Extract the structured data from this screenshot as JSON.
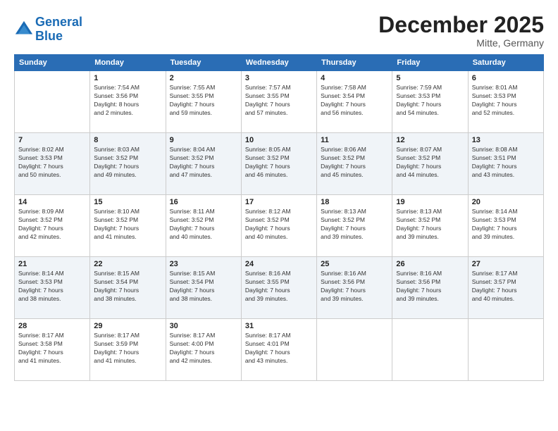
{
  "header": {
    "logo_line1": "General",
    "logo_line2": "Blue",
    "month": "December 2025",
    "location": "Mitte, Germany"
  },
  "weekdays": [
    "Sunday",
    "Monday",
    "Tuesday",
    "Wednesday",
    "Thursday",
    "Friday",
    "Saturday"
  ],
  "weeks": [
    [
      {
        "day": "",
        "info": ""
      },
      {
        "day": "1",
        "info": "Sunrise: 7:54 AM\nSunset: 3:56 PM\nDaylight: 8 hours\nand 2 minutes."
      },
      {
        "day": "2",
        "info": "Sunrise: 7:55 AM\nSunset: 3:55 PM\nDaylight: 7 hours\nand 59 minutes."
      },
      {
        "day": "3",
        "info": "Sunrise: 7:57 AM\nSunset: 3:55 PM\nDaylight: 7 hours\nand 57 minutes."
      },
      {
        "day": "4",
        "info": "Sunrise: 7:58 AM\nSunset: 3:54 PM\nDaylight: 7 hours\nand 56 minutes."
      },
      {
        "day": "5",
        "info": "Sunrise: 7:59 AM\nSunset: 3:53 PM\nDaylight: 7 hours\nand 54 minutes."
      },
      {
        "day": "6",
        "info": "Sunrise: 8:01 AM\nSunset: 3:53 PM\nDaylight: 7 hours\nand 52 minutes."
      }
    ],
    [
      {
        "day": "7",
        "info": "Sunrise: 8:02 AM\nSunset: 3:53 PM\nDaylight: 7 hours\nand 50 minutes."
      },
      {
        "day": "8",
        "info": "Sunrise: 8:03 AM\nSunset: 3:52 PM\nDaylight: 7 hours\nand 49 minutes."
      },
      {
        "day": "9",
        "info": "Sunrise: 8:04 AM\nSunset: 3:52 PM\nDaylight: 7 hours\nand 47 minutes."
      },
      {
        "day": "10",
        "info": "Sunrise: 8:05 AM\nSunset: 3:52 PM\nDaylight: 7 hours\nand 46 minutes."
      },
      {
        "day": "11",
        "info": "Sunrise: 8:06 AM\nSunset: 3:52 PM\nDaylight: 7 hours\nand 45 minutes."
      },
      {
        "day": "12",
        "info": "Sunrise: 8:07 AM\nSunset: 3:52 PM\nDaylight: 7 hours\nand 44 minutes."
      },
      {
        "day": "13",
        "info": "Sunrise: 8:08 AM\nSunset: 3:51 PM\nDaylight: 7 hours\nand 43 minutes."
      }
    ],
    [
      {
        "day": "14",
        "info": "Sunrise: 8:09 AM\nSunset: 3:52 PM\nDaylight: 7 hours\nand 42 minutes."
      },
      {
        "day": "15",
        "info": "Sunrise: 8:10 AM\nSunset: 3:52 PM\nDaylight: 7 hours\nand 41 minutes."
      },
      {
        "day": "16",
        "info": "Sunrise: 8:11 AM\nSunset: 3:52 PM\nDaylight: 7 hours\nand 40 minutes."
      },
      {
        "day": "17",
        "info": "Sunrise: 8:12 AM\nSunset: 3:52 PM\nDaylight: 7 hours\nand 40 minutes."
      },
      {
        "day": "18",
        "info": "Sunrise: 8:13 AM\nSunset: 3:52 PM\nDaylight: 7 hours\nand 39 minutes."
      },
      {
        "day": "19",
        "info": "Sunrise: 8:13 AM\nSunset: 3:52 PM\nDaylight: 7 hours\nand 39 minutes."
      },
      {
        "day": "20",
        "info": "Sunrise: 8:14 AM\nSunset: 3:53 PM\nDaylight: 7 hours\nand 39 minutes."
      }
    ],
    [
      {
        "day": "21",
        "info": "Sunrise: 8:14 AM\nSunset: 3:53 PM\nDaylight: 7 hours\nand 38 minutes."
      },
      {
        "day": "22",
        "info": "Sunrise: 8:15 AM\nSunset: 3:54 PM\nDaylight: 7 hours\nand 38 minutes."
      },
      {
        "day": "23",
        "info": "Sunrise: 8:15 AM\nSunset: 3:54 PM\nDaylight: 7 hours\nand 38 minutes."
      },
      {
        "day": "24",
        "info": "Sunrise: 8:16 AM\nSunset: 3:55 PM\nDaylight: 7 hours\nand 39 minutes."
      },
      {
        "day": "25",
        "info": "Sunrise: 8:16 AM\nSunset: 3:56 PM\nDaylight: 7 hours\nand 39 minutes."
      },
      {
        "day": "26",
        "info": "Sunrise: 8:16 AM\nSunset: 3:56 PM\nDaylight: 7 hours\nand 39 minutes."
      },
      {
        "day": "27",
        "info": "Sunrise: 8:17 AM\nSunset: 3:57 PM\nDaylight: 7 hours\nand 40 minutes."
      }
    ],
    [
      {
        "day": "28",
        "info": "Sunrise: 8:17 AM\nSunset: 3:58 PM\nDaylight: 7 hours\nand 41 minutes."
      },
      {
        "day": "29",
        "info": "Sunrise: 8:17 AM\nSunset: 3:59 PM\nDaylight: 7 hours\nand 41 minutes."
      },
      {
        "day": "30",
        "info": "Sunrise: 8:17 AM\nSunset: 4:00 PM\nDaylight: 7 hours\nand 42 minutes."
      },
      {
        "day": "31",
        "info": "Sunrise: 8:17 AM\nSunset: 4:01 PM\nDaylight: 7 hours\nand 43 minutes."
      },
      {
        "day": "",
        "info": ""
      },
      {
        "day": "",
        "info": ""
      },
      {
        "day": "",
        "info": ""
      }
    ]
  ]
}
